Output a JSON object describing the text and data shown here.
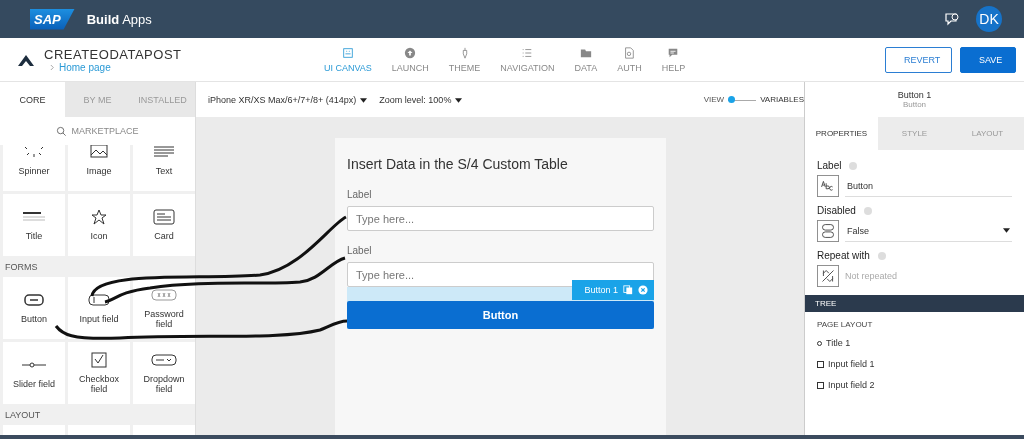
{
  "top_bar": {
    "logo": "SAP",
    "product": "Build",
    "product_suffix": "Apps",
    "avatar": "DK"
  },
  "header": {
    "app_name": "CREATEODATAPOST",
    "breadcrumb": "Home page",
    "nav": [
      {
        "label": "UI CANVAS",
        "kind": "canvas",
        "selected": true
      },
      {
        "label": "LAUNCH",
        "kind": "launch",
        "selected": false
      },
      {
        "label": "THEME",
        "kind": "theme",
        "selected": false
      },
      {
        "label": "NAVIGATION",
        "kind": "list",
        "selected": false
      },
      {
        "label": "DATA",
        "kind": "folder",
        "selected": false
      },
      {
        "label": "AUTH",
        "kind": "document",
        "selected": false
      },
      {
        "label": "HELP",
        "kind": "chat",
        "selected": false
      }
    ],
    "buttons": [
      {
        "label": "REVERT",
        "kind": "secondary"
      },
      {
        "label": "SAVE",
        "kind": "primary"
      }
    ]
  },
  "left_panel": {
    "tabs": [
      {
        "label": "CORE",
        "selected": true
      },
      {
        "label": "BY ME",
        "selected": false
      },
      {
        "label": "INSTALLED",
        "selected": false
      }
    ],
    "search": {
      "placeholder": "MARKETPLACE"
    },
    "sections": [
      {
        "items": [
          {
            "label": "Spinner",
            "kind": "spinner"
          },
          {
            "label": "Image",
            "kind": "image"
          },
          {
            "label": "Text",
            "kind": "text"
          },
          {
            "label": "Title",
            "kind": "title"
          },
          {
            "label": "Icon",
            "kind": "star"
          },
          {
            "label": "Card",
            "kind": "card"
          }
        ]
      },
      {
        "title": "FORMS",
        "items": [
          {
            "label": "Button",
            "kind": "button"
          },
          {
            "label": "Input field",
            "kind": "input"
          },
          {
            "label": "Password field",
            "kind": "password"
          },
          {
            "label": "Slider field",
            "kind": "slider"
          },
          {
            "label": "Checkbox field",
            "kind": "checkbox"
          },
          {
            "label": "Dropdown field",
            "kind": "dropdown"
          }
        ]
      },
      {
        "title": "LAYOUT"
      }
    ]
  },
  "toolbar": {
    "device": "iPhone XR/XS Max/6+/7+/8+ (414px)",
    "zoom": "Zoom level: 100%",
    "mode_toggle": {
      "left": "VIEW",
      "right": "VARIABLES",
      "on": false
    }
  },
  "canvas": {
    "title": "Insert Data in the S/4 Custom Table",
    "fields": [
      {
        "label": "Label",
        "placeholder": "Type here..."
      },
      {
        "label": "Label",
        "placeholder": "Type here..."
      }
    ],
    "button": {
      "label": "Button",
      "selected": true,
      "tag": "Button 1"
    }
  },
  "right_panel": {
    "selection": {
      "name": "Button 1",
      "type": "Button"
    },
    "tabs": [
      {
        "label": "PROPERTIES",
        "selected": true
      },
      {
        "label": "STYLE",
        "selected": false
      },
      {
        "label": "LAYOUT",
        "selected": false
      }
    ],
    "properties": [
      {
        "kind": "text",
        "label": "Label",
        "value": "Button"
      },
      {
        "kind": "select",
        "label": "Disabled",
        "value": "False"
      },
      {
        "kind": "empty",
        "label": "Repeat with",
        "placeholder": "Not repeated"
      }
    ],
    "tree": {
      "title": "TREE",
      "section": "PAGE LAYOUT",
      "items": [
        {
          "label": "Title 1",
          "kind": "title"
        },
        {
          "label": "Input field 1",
          "kind": "input"
        },
        {
          "label": "Input field 2",
          "kind": "input"
        }
      ]
    }
  }
}
